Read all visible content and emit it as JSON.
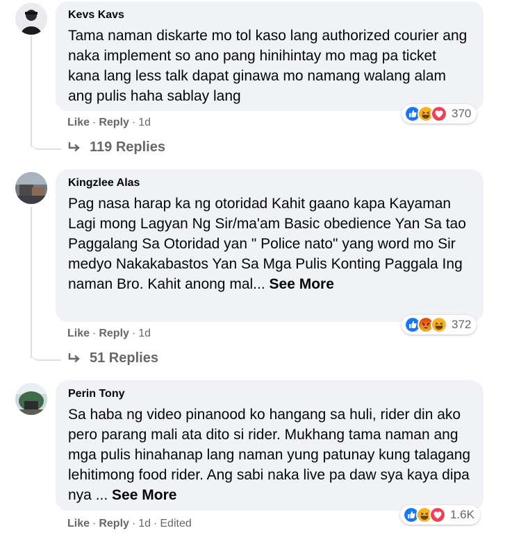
{
  "comments": [
    {
      "author": "Kevs Kavs",
      "text": "Tama naman diskarte mo tol kaso lang authorized courier ang naka implement so ano pang hinihintay mo mag pa ticket kana lang less talk dapat ginawa mo namang walang alam ang pulis haha sablay lang",
      "see_more": "",
      "reaction_icons": [
        "like",
        "haha",
        "love"
      ],
      "reaction_count": "370",
      "like_label": "Like",
      "reply_label": "Reply",
      "time": "1d",
      "edited": "",
      "replies_label": "119 Replies"
    },
    {
      "author": "Kingzlee Alas",
      "text": "Pag nasa harap ka ng otoridad Kahit gaano kapa Kayaman Lagi mong Lagyan Ng Sir/ma'am Basic obedience Yan Sa tao Paggalang Sa Otoridad yan \" Police nato\" yang word mo Sir medyo Nakakabastos Yan Sa Mga Pulis Konting Paggala Ing naman Bro. Kahit anong mal...",
      "see_more": "See More",
      "reaction_icons": [
        "like",
        "angry",
        "haha"
      ],
      "reaction_count": "372",
      "like_label": "Like",
      "reply_label": "Reply",
      "time": "1d",
      "edited": "",
      "replies_label": "51 Replies"
    },
    {
      "author": "Perin Tony",
      "text": "Sa haba ng video pinanood ko hangang sa huli, rider din ako pero parang mali ata dito si rider. Mukhang tama naman ang mga pulis hinahanap lang naman yung patunay kung talagang lehitimong food rider. Ang sabi naka live pa daw sya kaya dipa nya ...",
      "see_more": "See More",
      "reaction_icons": [
        "like",
        "haha",
        "love"
      ],
      "reaction_count": "1.6K",
      "like_label": "Like",
      "reply_label": "Reply",
      "time": "1d",
      "edited": "Edited",
      "replies_label": ""
    }
  ],
  "colors": {
    "like": "#1877f2",
    "love": "#f33e58",
    "haha": "#f7b125",
    "angry": "#e9710f",
    "bubble": "#f0f2f5",
    "secondary_text": "#65676b"
  }
}
